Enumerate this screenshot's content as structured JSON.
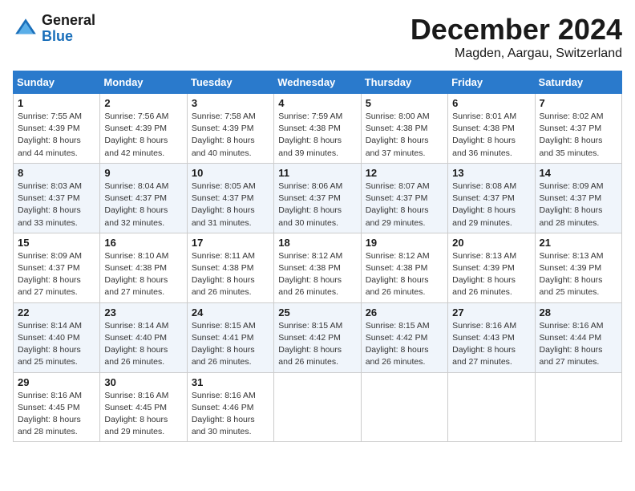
{
  "logo": {
    "text_general": "General",
    "text_blue": "Blue"
  },
  "header": {
    "month": "December 2024",
    "location": "Magden, Aargau, Switzerland"
  },
  "days_of_week": [
    "Sunday",
    "Monday",
    "Tuesday",
    "Wednesday",
    "Thursday",
    "Friday",
    "Saturday"
  ],
  "weeks": [
    [
      {
        "day": "1",
        "sunrise": "7:55 AM",
        "sunset": "4:39 PM",
        "daylight": "8 hours and 44 minutes."
      },
      {
        "day": "2",
        "sunrise": "7:56 AM",
        "sunset": "4:39 PM",
        "daylight": "8 hours and 42 minutes."
      },
      {
        "day": "3",
        "sunrise": "7:58 AM",
        "sunset": "4:39 PM",
        "daylight": "8 hours and 40 minutes."
      },
      {
        "day": "4",
        "sunrise": "7:59 AM",
        "sunset": "4:38 PM",
        "daylight": "8 hours and 39 minutes."
      },
      {
        "day": "5",
        "sunrise": "8:00 AM",
        "sunset": "4:38 PM",
        "daylight": "8 hours and 37 minutes."
      },
      {
        "day": "6",
        "sunrise": "8:01 AM",
        "sunset": "4:38 PM",
        "daylight": "8 hours and 36 minutes."
      },
      {
        "day": "7",
        "sunrise": "8:02 AM",
        "sunset": "4:37 PM",
        "daylight": "8 hours and 35 minutes."
      }
    ],
    [
      {
        "day": "8",
        "sunrise": "8:03 AM",
        "sunset": "4:37 PM",
        "daylight": "8 hours and 33 minutes."
      },
      {
        "day": "9",
        "sunrise": "8:04 AM",
        "sunset": "4:37 PM",
        "daylight": "8 hours and 32 minutes."
      },
      {
        "day": "10",
        "sunrise": "8:05 AM",
        "sunset": "4:37 PM",
        "daylight": "8 hours and 31 minutes."
      },
      {
        "day": "11",
        "sunrise": "8:06 AM",
        "sunset": "4:37 PM",
        "daylight": "8 hours and 30 minutes."
      },
      {
        "day": "12",
        "sunrise": "8:07 AM",
        "sunset": "4:37 PM",
        "daylight": "8 hours and 29 minutes."
      },
      {
        "day": "13",
        "sunrise": "8:08 AM",
        "sunset": "4:37 PM",
        "daylight": "8 hours and 29 minutes."
      },
      {
        "day": "14",
        "sunrise": "8:09 AM",
        "sunset": "4:37 PM",
        "daylight": "8 hours and 28 minutes."
      }
    ],
    [
      {
        "day": "15",
        "sunrise": "8:09 AM",
        "sunset": "4:37 PM",
        "daylight": "8 hours and 27 minutes."
      },
      {
        "day": "16",
        "sunrise": "8:10 AM",
        "sunset": "4:38 PM",
        "daylight": "8 hours and 27 minutes."
      },
      {
        "day": "17",
        "sunrise": "8:11 AM",
        "sunset": "4:38 PM",
        "daylight": "8 hours and 26 minutes."
      },
      {
        "day": "18",
        "sunrise": "8:12 AM",
        "sunset": "4:38 PM",
        "daylight": "8 hours and 26 minutes."
      },
      {
        "day": "19",
        "sunrise": "8:12 AM",
        "sunset": "4:38 PM",
        "daylight": "8 hours and 26 minutes."
      },
      {
        "day": "20",
        "sunrise": "8:13 AM",
        "sunset": "4:39 PM",
        "daylight": "8 hours and 26 minutes."
      },
      {
        "day": "21",
        "sunrise": "8:13 AM",
        "sunset": "4:39 PM",
        "daylight": "8 hours and 25 minutes."
      }
    ],
    [
      {
        "day": "22",
        "sunrise": "8:14 AM",
        "sunset": "4:40 PM",
        "daylight": "8 hours and 25 minutes."
      },
      {
        "day": "23",
        "sunrise": "8:14 AM",
        "sunset": "4:40 PM",
        "daylight": "8 hours and 26 minutes."
      },
      {
        "day": "24",
        "sunrise": "8:15 AM",
        "sunset": "4:41 PM",
        "daylight": "8 hours and 26 minutes."
      },
      {
        "day": "25",
        "sunrise": "8:15 AM",
        "sunset": "4:42 PM",
        "daylight": "8 hours and 26 minutes."
      },
      {
        "day": "26",
        "sunrise": "8:15 AM",
        "sunset": "4:42 PM",
        "daylight": "8 hours and 26 minutes."
      },
      {
        "day": "27",
        "sunrise": "8:16 AM",
        "sunset": "4:43 PM",
        "daylight": "8 hours and 27 minutes."
      },
      {
        "day": "28",
        "sunrise": "8:16 AM",
        "sunset": "4:44 PM",
        "daylight": "8 hours and 27 minutes."
      }
    ],
    [
      {
        "day": "29",
        "sunrise": "8:16 AM",
        "sunset": "4:45 PM",
        "daylight": "8 hours and 28 minutes."
      },
      {
        "day": "30",
        "sunrise": "8:16 AM",
        "sunset": "4:45 PM",
        "daylight": "8 hours and 29 minutes."
      },
      {
        "day": "31",
        "sunrise": "8:16 AM",
        "sunset": "4:46 PM",
        "daylight": "8 hours and 30 minutes."
      },
      null,
      null,
      null,
      null
    ]
  ]
}
